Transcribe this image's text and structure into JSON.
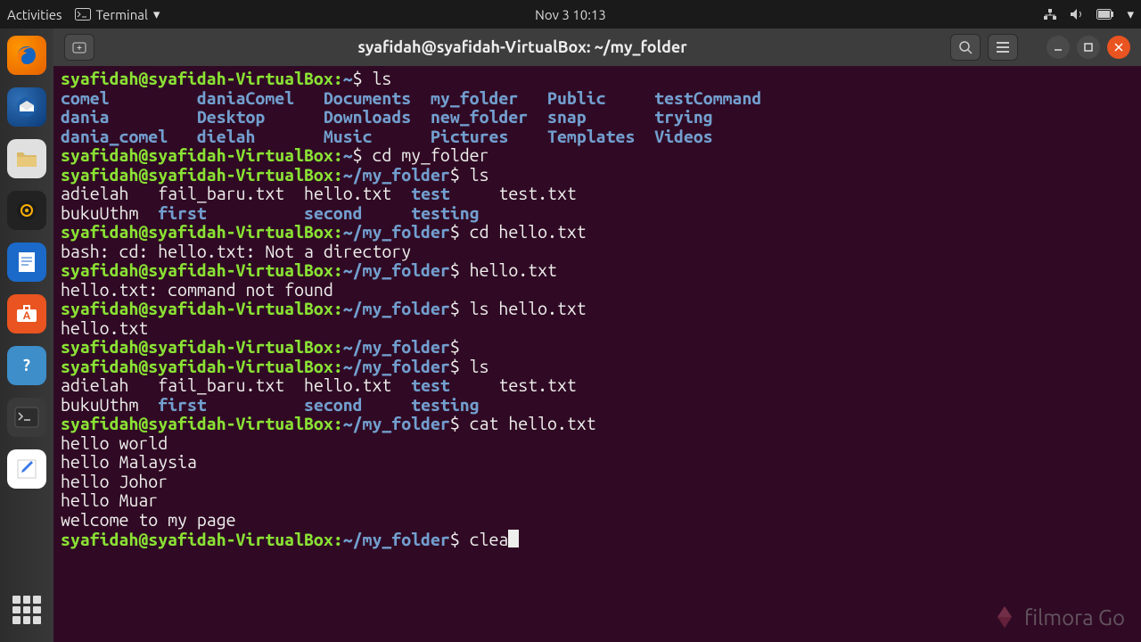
{
  "topbar": {
    "activities": "Activities",
    "app_label": "Terminal",
    "datetime": "Nov 3  10:13"
  },
  "window": {
    "title": "syafidah@syafidah-VirtualBox: ~/my_folder"
  },
  "prompt": {
    "user_host": "syafidah@syafidah-VirtualBox",
    "home": "~",
    "folder": "~/my_folder",
    "sep": ":",
    "sym": "$"
  },
  "cmds": {
    "ls": "ls",
    "cd_my_folder": "cd my_folder",
    "cd_hello": "cd hello.txt",
    "hello_txt": "hello.txt",
    "ls_hello": "ls hello.txt",
    "cat_hello": "cat hello.txt",
    "clea": "clea"
  },
  "ls_home": {
    "r1c1": "comel",
    "r1c2": "daniaComel",
    "r1c3": "Documents",
    "r1c4": "my_folder",
    "r1c5": "Public",
    "r1c6": "testCommand",
    "r2c1": "dania",
    "r2c2": "Desktop",
    "r2c3": "Downloads",
    "r2c4": "new_folder",
    "r2c5": "snap",
    "r2c6": "trying",
    "r3c1": "dania_comel",
    "r3c2": "dielah",
    "r3c3": "Music",
    "r3c4": "Pictures",
    "r3c5": "Templates",
    "r3c6": "Videos"
  },
  "ls_folder": {
    "r1c1": "adielah",
    "r1c2": "fail_baru.txt",
    "r1c3": "hello.txt",
    "r1c4": "test",
    "r1c5": "test.txt",
    "r2c1": "bukuUthm",
    "r2c2": "first",
    "r2c3": "second",
    "r2c4": "testing"
  },
  "errors": {
    "not_dir": "bash: cd: hello.txt: Not a directory",
    "not_found": "hello.txt: command not found"
  },
  "ls_hello_out": "hello.txt",
  "cat_out": {
    "l1": "hello world",
    "l2": "hello Malaysia",
    "l3": "hello Johor",
    "l4": "hello Muar",
    "l5": "welcome to my page"
  },
  "watermark": "filmora Go"
}
